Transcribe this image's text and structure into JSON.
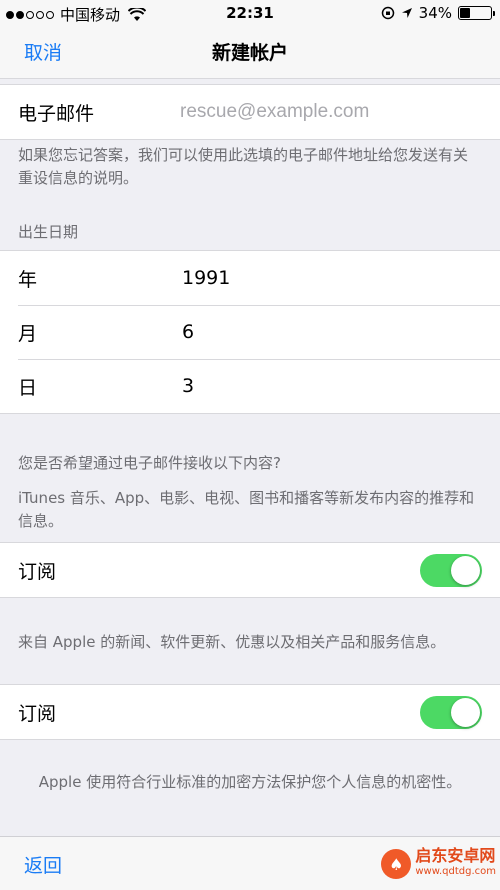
{
  "status_bar": {
    "carrier": "中国移动",
    "time": "22:31",
    "battery": "34%",
    "battery_level": 0.34
  },
  "nav": {
    "cancel": "取消",
    "title": "新建帐户"
  },
  "email": {
    "label": "电子邮件",
    "placeholder": "rescue@example.com",
    "note": "如果您忘记答案，我们可以使用此选填的电子邮件地址给您发送有关重设信息的说明。"
  },
  "birthdate": {
    "header": "出生日期",
    "rows": [
      {
        "label": "年",
        "value": "1991"
      },
      {
        "label": "月",
        "value": "6"
      },
      {
        "label": "日",
        "value": "3"
      }
    ]
  },
  "subscriptions": {
    "question": "您是否希望通过电子邮件接收以下内容?",
    "itunes_desc": "iTunes 音乐、App、电影、电视、图书和播客等新发布内容的推荐和信息。",
    "itunes_label": "订阅",
    "itunes_on": true,
    "apple_desc": "来自 Apple 的新闻、软件更新、优惠以及相关产品和服务信息。",
    "apple_label": "订阅",
    "apple_on": true
  },
  "footer": {
    "privacy": "Apple 使用符合行业标准的加密方法保护您个人信息的机密性。",
    "back": "返回"
  },
  "watermark": {
    "name": "启东安卓网",
    "url": "www.qdtdg.com"
  },
  "colors": {
    "accent": "#1a7cf5",
    "toggle_on": "#4cd964",
    "background": "#efeff4"
  }
}
